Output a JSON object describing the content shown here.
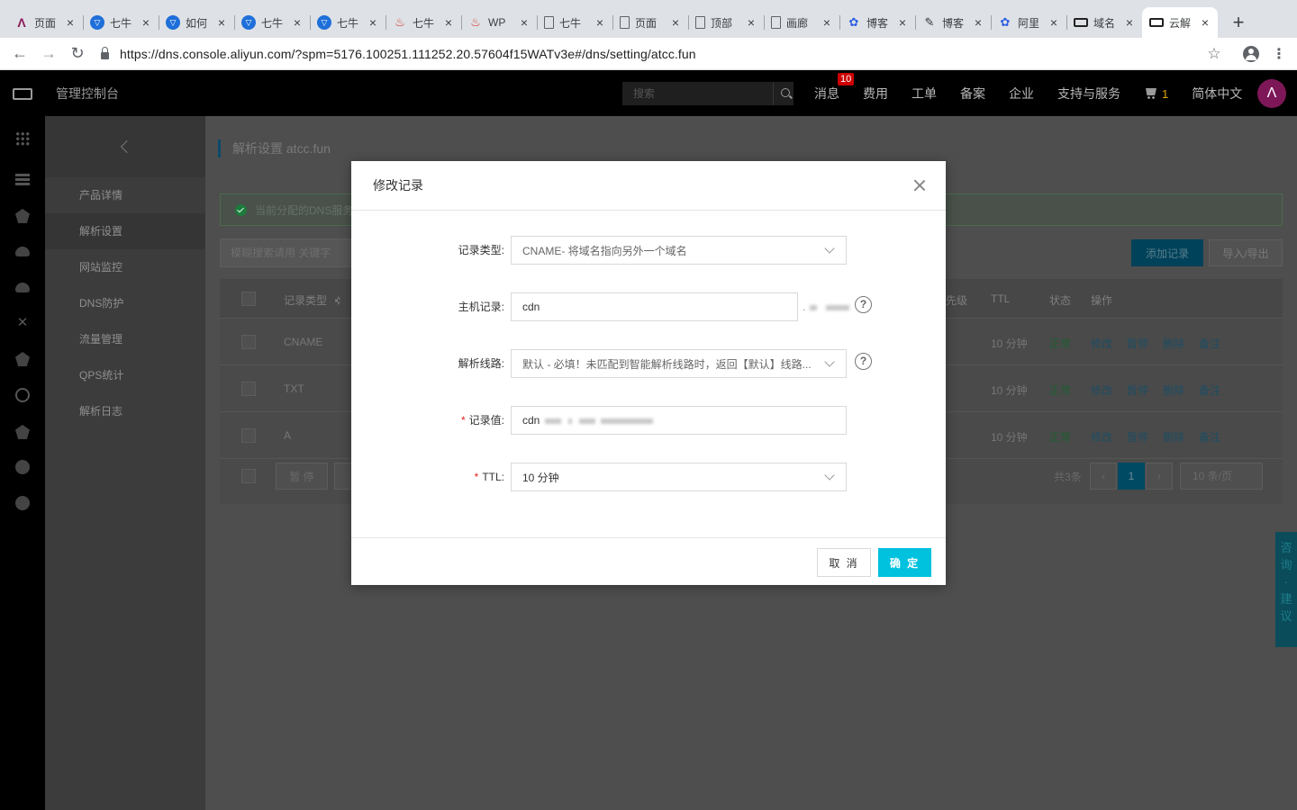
{
  "browser": {
    "tabs": [
      {
        "icon": "aliyun-icon",
        "title": "页面"
      },
      {
        "icon": "v-icon",
        "title": "七牛"
      },
      {
        "icon": "v-icon",
        "title": "如何"
      },
      {
        "icon": "v-icon",
        "title": "七牛"
      },
      {
        "icon": "v-icon",
        "title": "七牛"
      },
      {
        "icon": "w-icon",
        "title": "七牛"
      },
      {
        "icon": "w-icon",
        "title": "WP"
      },
      {
        "icon": "doc-icon",
        "title": "七牛"
      },
      {
        "icon": "doc-icon",
        "title": "页面"
      },
      {
        "icon": "doc-icon",
        "title": "顶部"
      },
      {
        "icon": "doc-icon",
        "title": "画廊"
      },
      {
        "icon": "paw-icon",
        "title": "博客"
      },
      {
        "icon": "quill-icon",
        "title": "博客"
      },
      {
        "icon": "paw-icon",
        "title": "阿里"
      },
      {
        "icon": "yun-icon",
        "title": "域名"
      },
      {
        "icon": "yun-icon",
        "title": "云解"
      }
    ],
    "url": "https://dns.console.aliyun.com/?spm=5176.100251.111252.20.57604f15WATv3e#/dns/setting/atcc.fun"
  },
  "topbar": {
    "title": "管理控制台",
    "search_placeholder": "搜索",
    "nav": {
      "messages": "消息",
      "messages_badge": "10",
      "billing": "费用",
      "tickets": "工单",
      "icp": "备案",
      "enterprise": "企业",
      "support": "支持与服务",
      "cart_count": "1",
      "language": "简体中文"
    },
    "avatar_letter": "Λ"
  },
  "sidebar": {
    "items": [
      "产品详情",
      "解析设置",
      "网站监控",
      "DNS防护",
      "流量管理",
      "QPS统计",
      "解析日志"
    ]
  },
  "main": {
    "title": "解析设置 atcc.fun",
    "notice": "当前分配的DNS服务",
    "search_placeholder": "模糊搜索请用 关键字",
    "add_button": "添加记录",
    "import_export": "导入/导出",
    "table": {
      "headers": {
        "type": "记录类型",
        "priority": "先级",
        "ttl": "TTL",
        "status": "状态",
        "actions": "操作"
      },
      "rows": [
        {
          "type": "CNAME",
          "ttl": "10 分钟",
          "status": "正常"
        },
        {
          "type": "TXT",
          "ttl": "10 分钟",
          "status": "正常"
        },
        {
          "type": "A",
          "ttl": "10 分钟",
          "status": "正常"
        }
      ],
      "actions": [
        "修改",
        "暂停",
        "删除",
        "备注"
      ]
    },
    "pause_button": "暂 停",
    "total": "共3条",
    "current_page": "1",
    "page_size": "10 条/页",
    "feedback": [
      "咨",
      "询",
      "·",
      "建",
      "议"
    ]
  },
  "modal": {
    "title": "修改记录",
    "fields": {
      "record_type": {
        "label": "记录类型:",
        "value": "CNAME- 将域名指向另外一个域名"
      },
      "host": {
        "label": "主机记录:",
        "value": "cdn"
      },
      "line": {
        "label": "解析线路:",
        "value": "默认 - 必填！未匹配到智能解析线路时，返回【默认】线路..."
      },
      "record_value": {
        "label": "记录值:",
        "value": "cdn"
      },
      "ttl": {
        "label": "TTL:",
        "value": "10 分钟"
      }
    },
    "cancel": "取 消",
    "ok": "确 定"
  }
}
